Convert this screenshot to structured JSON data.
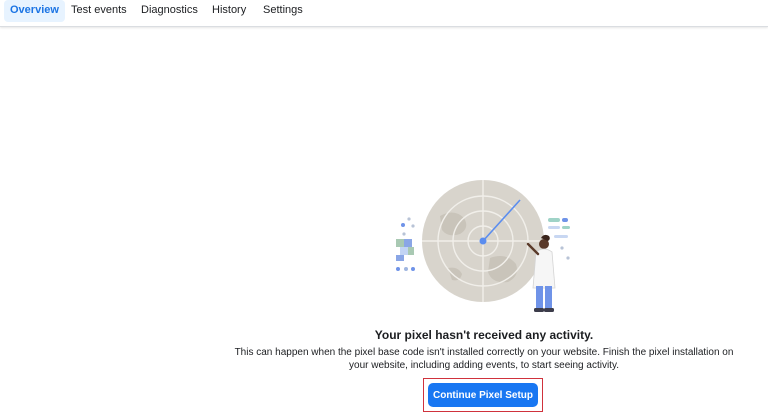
{
  "tabs": [
    {
      "label": "Overview",
      "active": true
    },
    {
      "label": "Test events",
      "active": false
    },
    {
      "label": "Diagnostics",
      "active": false
    },
    {
      "label": "History",
      "active": false
    },
    {
      "label": "Settings",
      "active": false
    }
  ],
  "empty_state": {
    "illustration": "radar-with-scientist-illustration",
    "heading": "Your pixel hasn't received any activity.",
    "description": "This can happen when the pixel base code isn't installed correctly on your website. Finish the pixel installation on your website, including adding events, to start seeing activity.",
    "button_label": "Continue Pixel Setup"
  },
  "colors": {
    "accent": "#1877f2",
    "active_tab_bg": "#e7f3ff",
    "active_tab_text": "#1b74e4",
    "highlight_frame": "#d0323c"
  }
}
